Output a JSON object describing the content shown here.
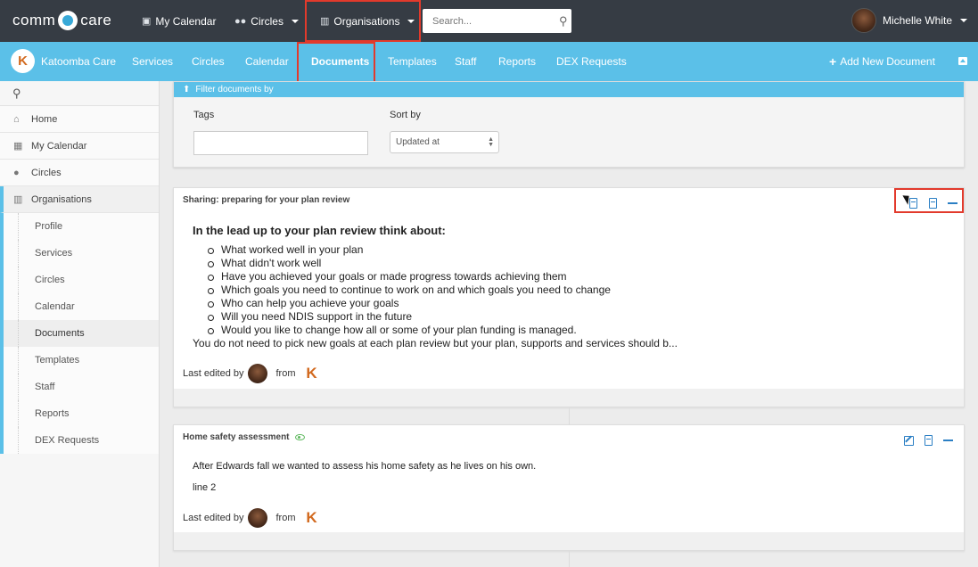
{
  "brand": {
    "logo_text_left": "comm",
    "logo_text_right": "care"
  },
  "topnav": {
    "my_calendar": "My Calendar",
    "circles": "Circles",
    "organisations": "Organisations",
    "search_placeholder": "Search...",
    "user_name": "Michelle White"
  },
  "orgnav": {
    "org_name": "Katoomba Care",
    "tabs": [
      "Services",
      "Circles",
      "Calendar",
      "Documents",
      "Templates",
      "Staff",
      "Reports",
      "DEX Requests"
    ],
    "active_tab": "Documents",
    "add_document": "Add New Document"
  },
  "sidebar": {
    "items": [
      "Home",
      "My Calendar",
      "Circles",
      "Organisations"
    ],
    "sub_items": [
      "Profile",
      "Services",
      "Circles",
      "Calendar",
      "Documents",
      "Templates",
      "Staff",
      "Reports",
      "DEX Requests"
    ],
    "current_sub": "Documents"
  },
  "filter": {
    "header": "Filter documents by",
    "tags_label": "Tags",
    "tags_value": "",
    "sort_label": "Sort by",
    "sort_value": "Updated at"
  },
  "documents": [
    {
      "title": "Sharing: preparing for your plan review",
      "heading": "In the lead up to your plan review think about:",
      "bullets": [
        "What worked well in your plan",
        "What didn't work well",
        "Have you achieved your goals or made progress towards achieving them",
        "Which goals you need to continue to work on and which goals you need to change",
        "Who can help you achieve your goals",
        "Will you need NDIS support in the future",
        "Would you like to change how all or some of your plan funding is managed."
      ],
      "paragraph": "You do not need to pick new goals at each plan review but your plan, supports and services should b...",
      "last_edited_by": "Last edited by",
      "from": "from"
    },
    {
      "title": "Home safety assessment",
      "paragraph": "After Edwards fall we wanted to assess his home safety as he lives on his own.",
      "line2": "line 2",
      "last_edited_by": "Last edited by",
      "from": "from"
    }
  ],
  "colors": {
    "topbar": "#363c44",
    "accent": "#5bc0e8",
    "highlight": "#e23a2c",
    "action_blue": "#2b7fc4"
  }
}
